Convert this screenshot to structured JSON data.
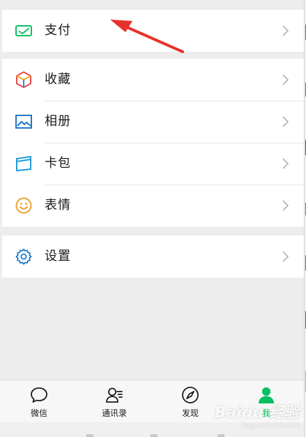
{
  "menu": {
    "group1": [
      {
        "label": "支付",
        "icon": "wallet-icon"
      }
    ],
    "group2": [
      {
        "label": "收藏",
        "icon": "cube-icon"
      },
      {
        "label": "相册",
        "icon": "photo-icon"
      },
      {
        "label": "卡包",
        "icon": "card-icon"
      },
      {
        "label": "表情",
        "icon": "smiley-icon"
      }
    ],
    "group3": [
      {
        "label": "设置",
        "icon": "gear-icon"
      }
    ]
  },
  "tabbar": {
    "tabs": [
      {
        "label": "微信",
        "icon": "chat-bubble-icon",
        "active": false
      },
      {
        "label": "通讯录",
        "icon": "contacts-icon",
        "active": false
      },
      {
        "label": "发现",
        "icon": "compass-icon",
        "active": false
      },
      {
        "label": "我",
        "icon": "person-icon",
        "active": true
      }
    ]
  },
  "watermark": {
    "main": "Baidu 经验",
    "sub": "jingyan.baidu.com"
  },
  "colors": {
    "accent": "#07c160",
    "background": "#ededed",
    "annotation_arrow": "#e8312a",
    "icon_blue": "#1e78c8",
    "icon_orange": "#e8a030"
  }
}
